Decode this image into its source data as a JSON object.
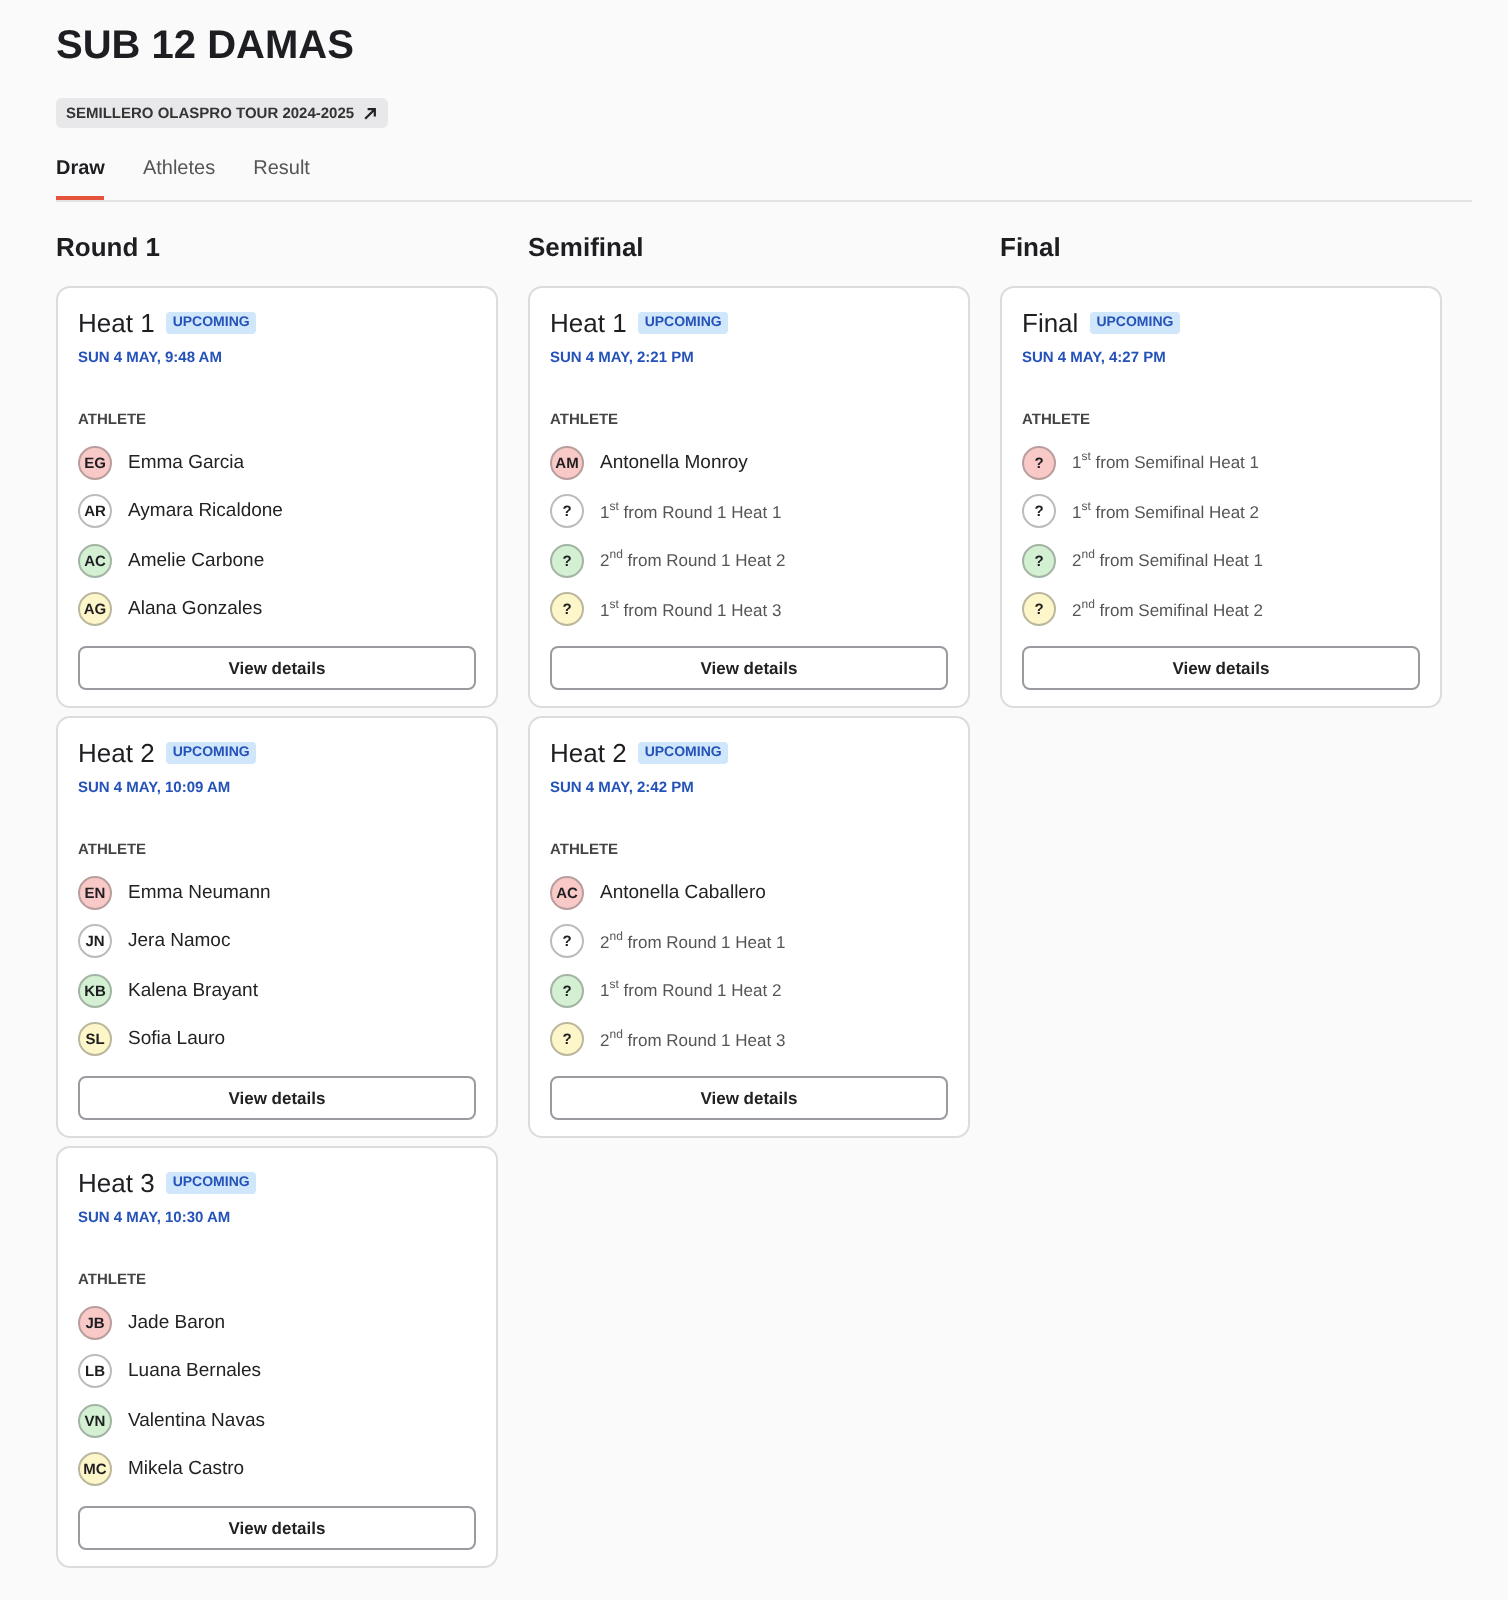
{
  "title": "SUB 12 DAMAS",
  "tour_chip": {
    "label": "SEMILLERO OLASPRO TOUR 2024-2025"
  },
  "tabs": [
    {
      "label": "Draw",
      "selected": true
    },
    {
      "label": "Athletes",
      "selected": false
    },
    {
      "label": "Result",
      "selected": false
    }
  ],
  "rounds": [
    {
      "name": "Round 1",
      "heats": [
        {
          "name": "Heat 1",
          "status": "UPCOMING",
          "time": "SUN 4 MAY, 9:48 AM",
          "column_label": "ATHLETE",
          "button": "View details",
          "athletes": [
            {
              "kind": "athlete",
              "initials": "EG",
              "name": "Emma Garcia",
              "color": "#f8c9c6"
            },
            {
              "kind": "athlete",
              "initials": "AR",
              "name": "Aymara Ricaldone",
              "color": "#ffffff"
            },
            {
              "kind": "athlete",
              "initials": "AC",
              "name": "Amelie Carbone",
              "color": "#d3f0d3"
            },
            {
              "kind": "athlete",
              "initials": "AG",
              "name": "Alana Gonzales",
              "color": "#fdf6c8"
            }
          ]
        },
        {
          "name": "Heat 2",
          "status": "UPCOMING",
          "time": "SUN 4 MAY, 10:09 AM",
          "column_label": "ATHLETE",
          "button": "View details",
          "athletes": [
            {
              "kind": "athlete",
              "initials": "EN",
              "name": "Emma Neumann",
              "color": "#f8c9c6"
            },
            {
              "kind": "athlete",
              "initials": "JN",
              "name": "Jera Namoc",
              "color": "#ffffff"
            },
            {
              "kind": "athlete",
              "initials": "KB",
              "name": "Kalena Brayant",
              "color": "#d3f0d3"
            },
            {
              "kind": "athlete",
              "initials": "SL",
              "name": "Sofia Lauro",
              "color": "#fdf6c8"
            }
          ]
        },
        {
          "name": "Heat 3",
          "status": "UPCOMING",
          "time": "SUN 4 MAY, 10:30 AM",
          "column_label": "ATHLETE",
          "button": "View details",
          "athletes": [
            {
              "kind": "athlete",
              "initials": "JB",
              "name": "Jade Baron",
              "color": "#f8c9c6"
            },
            {
              "kind": "athlete",
              "initials": "LB",
              "name": "Luana Bernales",
              "color": "#ffffff"
            },
            {
              "kind": "athlete",
              "initials": "VN",
              "name": "Valentina Navas",
              "color": "#d3f0d3"
            },
            {
              "kind": "athlete",
              "initials": "MC",
              "name": "Mikela Castro",
              "color": "#fdf6c8"
            }
          ]
        }
      ]
    },
    {
      "name": "Semifinal",
      "heats": [
        {
          "name": "Heat 1",
          "status": "UPCOMING",
          "time": "SUN 4 MAY, 2:21 PM",
          "column_label": "ATHLETE",
          "button": "View details",
          "athletes": [
            {
              "kind": "athlete",
              "initials": "AM",
              "name": "Antonella Monroy",
              "color": "#f8c9c6"
            },
            {
              "kind": "placeholder",
              "initials": "?",
              "name": "1$^{st}$ from Round 1 Heat 1",
              "color": "#ffffff"
            },
            {
              "kind": "placeholder",
              "initials": "?",
              "name": "2$^{nd}$ from Round 1 Heat 2",
              "color": "#d3f0d3"
            },
            {
              "kind": "placeholder",
              "initials": "?",
              "name": "1$^{st}$ from Round 1 Heat 3",
              "color": "#fdf6c8"
            }
          ]
        },
        {
          "name": "Heat 2",
          "status": "UPCOMING",
          "time": "SUN 4 MAY, 2:42 PM",
          "column_label": "ATHLETE",
          "button": "View details",
          "athletes": [
            {
              "kind": "athlete",
              "initials": "AC",
              "name": "Antonella Caballero",
              "color": "#f8c9c6"
            },
            {
              "kind": "placeholder",
              "initials": "?",
              "name": "2$^{nd}$ from Round 1 Heat 1",
              "color": "#ffffff"
            },
            {
              "kind": "placeholder",
              "initials": "?",
              "name": "1$^{st}$ from Round 1 Heat 2",
              "color": "#d3f0d3"
            },
            {
              "kind": "placeholder",
              "initials": "?",
              "name": "2$^{nd}$ from Round 1 Heat 3",
              "color": "#fdf6c8"
            }
          ]
        }
      ]
    },
    {
      "name": "Final",
      "heats": [
        {
          "name": "Final",
          "status": "UPCOMING",
          "time": "SUN 4 MAY, 4:27 PM",
          "column_label": "ATHLETE",
          "button": "View details",
          "athletes": [
            {
              "kind": "placeholder",
              "initials": "?",
              "name": "1$^{st}$ from Semifinal Heat 1",
              "color": "#f8c9c6"
            },
            {
              "kind": "placeholder",
              "initials": "?",
              "name": "1$^{st}$ from Semifinal Heat 2",
              "color": "#ffffff"
            },
            {
              "kind": "placeholder",
              "initials": "?",
              "name": "2$^{nd}$ from Semifinal Heat 1",
              "color": "#d3f0d3"
            },
            {
              "kind": "placeholder",
              "initials": "?",
              "name": "2$^{nd}$ from Semifinal Heat 2",
              "color": "#fdf6c8"
            }
          ]
        }
      ]
    }
  ]
}
